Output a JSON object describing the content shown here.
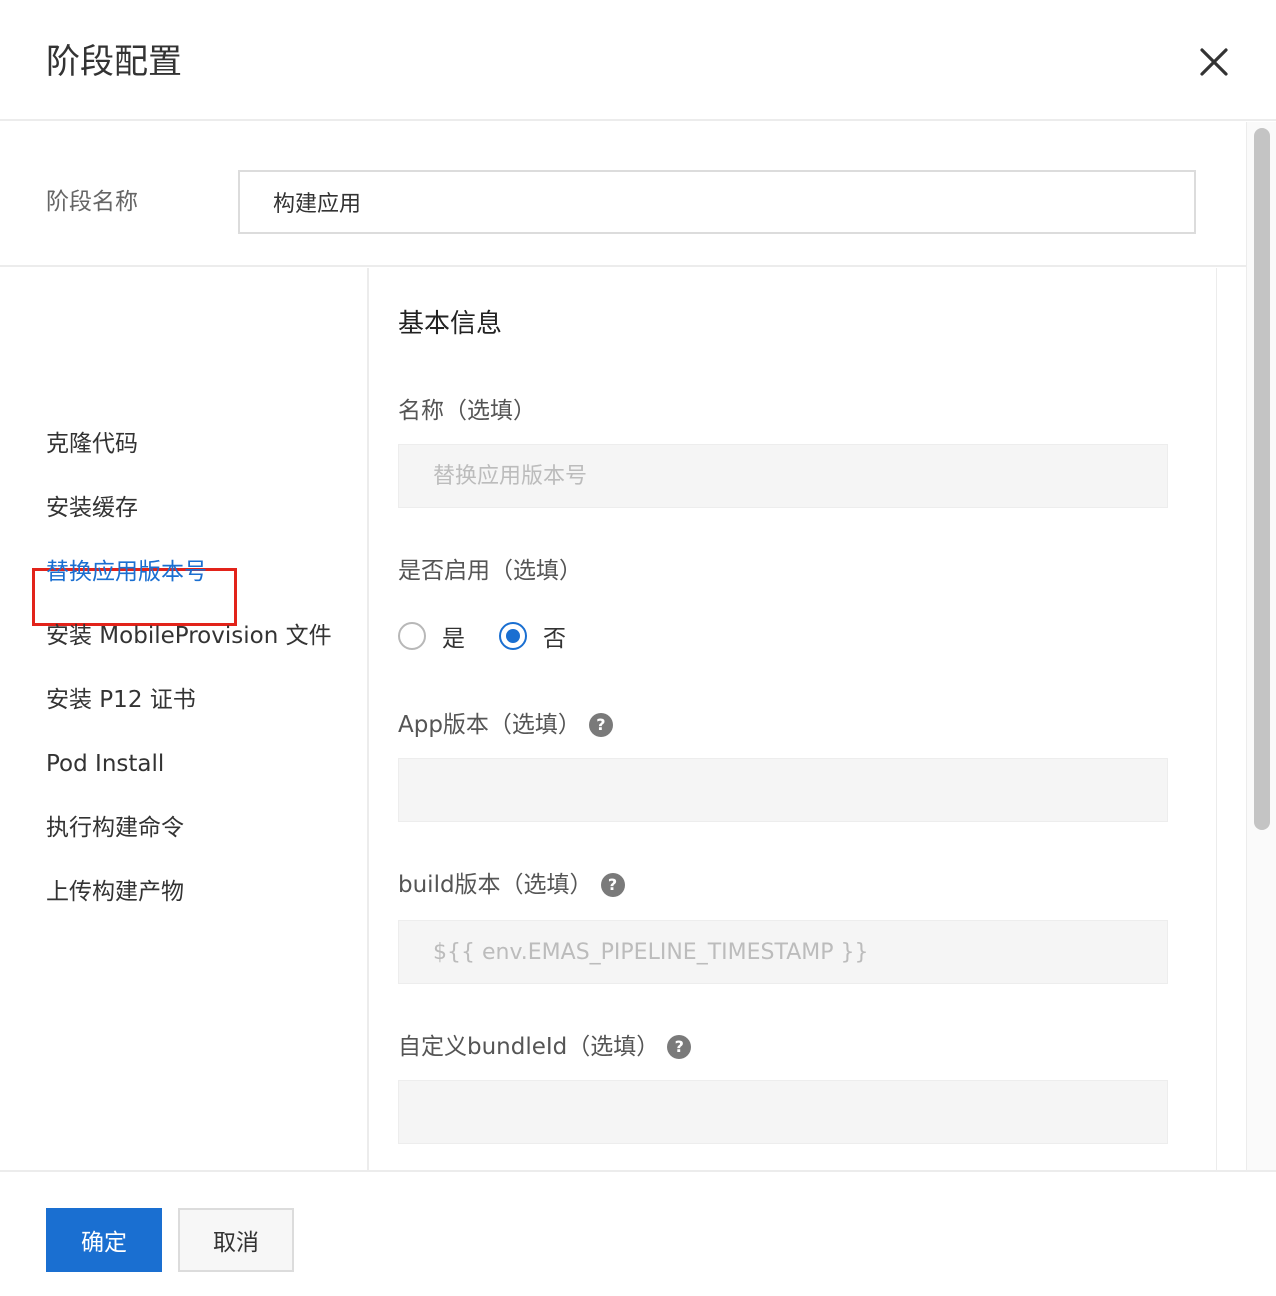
{
  "dialog": {
    "title": "阶段配置",
    "close_icon": "close-icon"
  },
  "stage": {
    "label": "阶段名称",
    "value": "构建应用"
  },
  "nav": {
    "items": [
      {
        "label": "克隆代码"
      },
      {
        "label": "安装缓存"
      },
      {
        "label": "替换应用版本号"
      },
      {
        "label": "安装 MobileProvision 文件"
      },
      {
        "label": "安装 P12 证书"
      },
      {
        "label": "Pod Install"
      },
      {
        "label": "执行构建命令"
      },
      {
        "label": "上传构建产物"
      }
    ],
    "active_index": 2,
    "active_color": "#1a6fd1",
    "highlight_color": "#e2231a"
  },
  "form": {
    "section_title": "基本信息",
    "name": {
      "label": "名称（选填）",
      "placeholder": "替换应用版本号",
      "value": ""
    },
    "enabled": {
      "label": "是否启用（选填）",
      "options": [
        {
          "label": "是",
          "checked": false
        },
        {
          "label": "否",
          "checked": true
        }
      ]
    },
    "app_version": {
      "label": "App版本（选填）",
      "help": "?",
      "value": ""
    },
    "build_version": {
      "label": "build版本（选填）",
      "help": "?",
      "placeholder": "${{ env.EMAS_PIPELINE_TIMESTAMP }}",
      "value": ""
    },
    "bundle_id": {
      "label": "自定义bundleId（选填）",
      "help": "?",
      "value": ""
    }
  },
  "footer": {
    "ok_label": "确定",
    "cancel_label": "取消"
  }
}
